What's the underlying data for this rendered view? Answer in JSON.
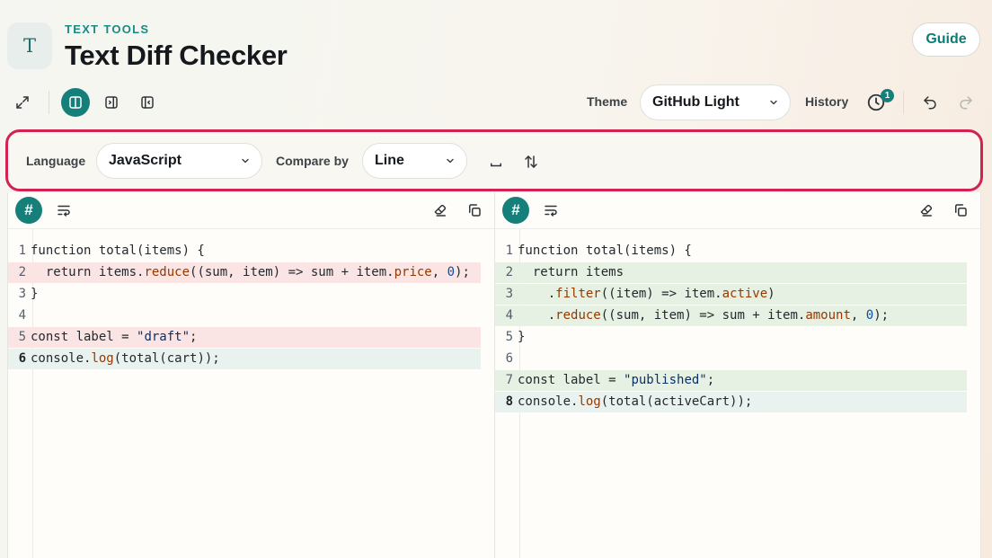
{
  "header": {
    "logo_letter": "T",
    "kicker": "TEXT TOOLS",
    "title": "Text Diff Checker",
    "guide_label": "Guide"
  },
  "toolbar": {
    "theme_label": "Theme",
    "theme_value": "GitHub Light",
    "history_label": "History",
    "history_badge": "1"
  },
  "options": {
    "language_label": "Language",
    "language_value": "JavaScript",
    "compare_label": "Compare by",
    "compare_value": "Line"
  },
  "left_pane": {
    "hash": "#",
    "lines": [
      {
        "n": "1",
        "text": "function total(items) {",
        "hl": ""
      },
      {
        "n": "2",
        "text": "  return items.reduce((sum, item) => sum + item.price, 0);",
        "hl": "del"
      },
      {
        "n": "3",
        "text": "}",
        "hl": ""
      },
      {
        "n": "4",
        "text": "",
        "hl": ""
      },
      {
        "n": "5",
        "text": "const label = \"draft\";",
        "hl": "del"
      },
      {
        "n": "6",
        "text": "console.log(total(cart));",
        "hl": "cur"
      }
    ]
  },
  "right_pane": {
    "hash": "#",
    "lines": [
      {
        "n": "1",
        "text": "function total(items) {",
        "hl": ""
      },
      {
        "n": "2",
        "text": "  return items",
        "hl": "add"
      },
      {
        "n": "3",
        "text": "    .filter((item) => item.active)",
        "hl": "add"
      },
      {
        "n": "4",
        "text": "    .reduce((sum, item) => sum + item.amount, 0);",
        "hl": "add"
      },
      {
        "n": "5",
        "text": "}",
        "hl": ""
      },
      {
        "n": "6",
        "text": "",
        "hl": ""
      },
      {
        "n": "7",
        "text": "const label = \"published\";",
        "hl": "add"
      },
      {
        "n": "8",
        "text": "console.log(total(activeCart));",
        "hl": "cur"
      }
    ]
  },
  "colors": {
    "accent": "#167f7a",
    "highlight_border": "#d32251",
    "deleted_bg": "#fbe5e4",
    "added_bg": "#e6f1e3"
  }
}
